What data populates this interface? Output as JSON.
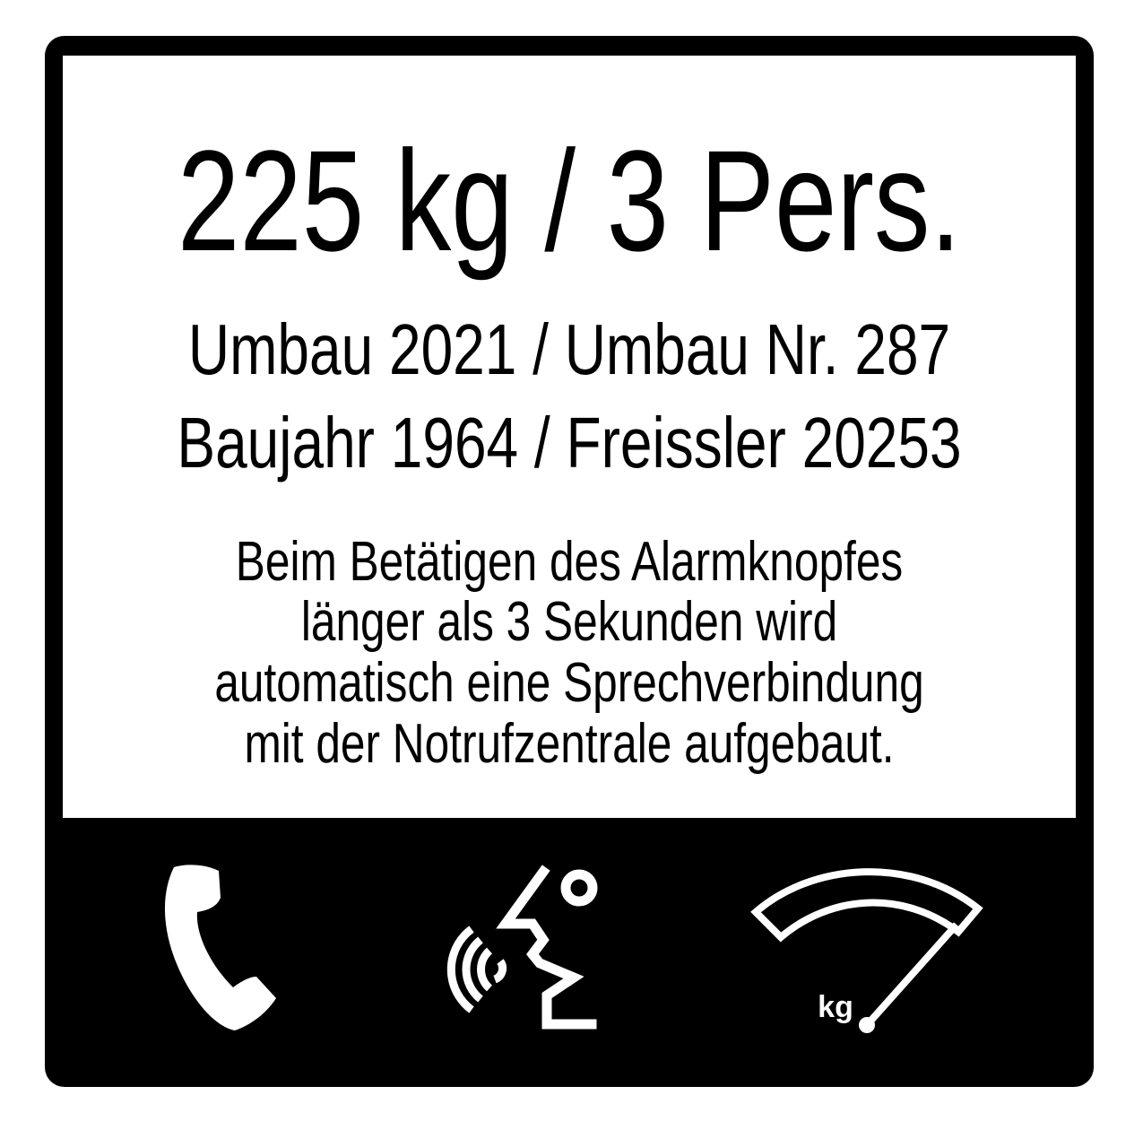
{
  "sign": {
    "capacity": "225 kg / 3 Pers.",
    "info_line_1": "Umbau 2021 / Umbau Nr. 287",
    "info_line_2": "Baujahr 1964 / Freissler 20253",
    "notice_lines": [
      "Beim Betätigen des Alarmknopfes",
      "länger als 3 Sekunden wird",
      "automatisch eine Sprechverbindung",
      "mit der Notrufzentrale aufgebaut."
    ]
  },
  "icons": {
    "phone": "phone-handset-icon",
    "speech": "speaking-head-icon",
    "load": "load-gauge-icon",
    "load_unit": "kg"
  },
  "colors": {
    "foreground": "#000000",
    "background": "#ffffff"
  }
}
